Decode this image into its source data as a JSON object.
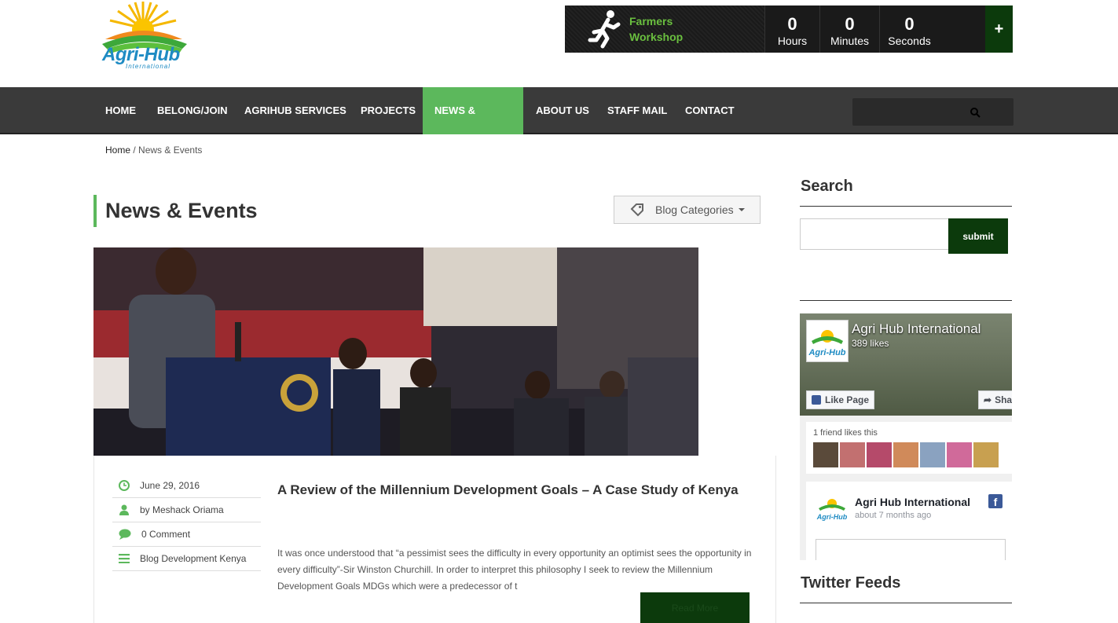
{
  "brand": {
    "name": "Agri-Hub",
    "subname": "International"
  },
  "countdown": {
    "event": "Farmers Workshop",
    "units": [
      {
        "value": "0",
        "label": "Hours"
      },
      {
        "value": "0",
        "label": "Minutes"
      },
      {
        "value": "0",
        "label": "Seconds"
      }
    ],
    "plus": "+"
  },
  "nav": {
    "items": [
      "HOME",
      "BELONG/JOIN",
      "AGRIHUB SERVICES",
      "PROJECTS",
      "NEWS & EVENTS",
      "ABOUT US",
      "STAFF MAIL",
      "CONTACT"
    ],
    "active": "NEWS & EVENTS"
  },
  "breadcrumb": {
    "home": "Home",
    "separator": "/",
    "current": "News & Events"
  },
  "main": {
    "title": "News & Events",
    "categories_button": "Blog Categories"
  },
  "post": {
    "date": "June 29, 2016",
    "author": "by Meshack Oriama",
    "comments": "0 Comment",
    "category": "Blog Development Kenya",
    "title": "A Review of the Millennium Development Goals – A Case Study of Kenya",
    "excerpt": "It was once understood that “a pessimist sees the difficulty in every opportunity an optimist sees the opportunity in every difficulty”-Sir Winston Churchill. In order to interpret this philosophy I seek to review the Millennium Development Goals MDGs which were a predecessor of t",
    "read_more": "Read More"
  },
  "sidebar": {
    "search_heading": "Search",
    "submit_label": "submit",
    "facebook": {
      "page_name": "Agri Hub International",
      "likes": "389 likes",
      "like_button": "Like Page",
      "share_button": "Sha",
      "friends_text": "1 friend likes this",
      "post_name": "Agri Hub International",
      "post_time": "about 7 months ago"
    },
    "twitter_heading": "Twitter Feeds"
  },
  "colors": {
    "accent_green": "#5cb85c",
    "dark_green": "#0c3a0c",
    "nav_bg": "#3a3a3a"
  },
  "icons": [
    "runner-icon",
    "search-icon",
    "tag-icon",
    "clock-icon",
    "user-icon",
    "comment-icon",
    "list-icon",
    "facebook-icon"
  ]
}
